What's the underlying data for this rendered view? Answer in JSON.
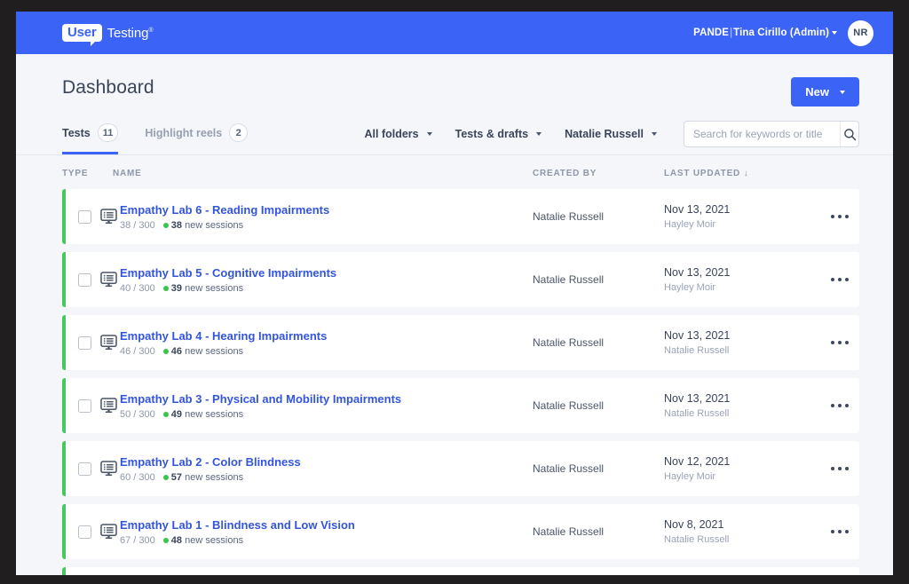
{
  "topbar": {
    "logo_bubble": "User",
    "logo_word": "Testing",
    "logo_tm": "®",
    "account_org": "PANDE",
    "account_separator": "|",
    "account_user": "Tina Cirillo (Admin)",
    "avatar_initials": "NR",
    "bar_color": "#3b63f5"
  },
  "header": {
    "title": "Dashboard",
    "new_button": "New"
  },
  "tabs": [
    {
      "label": "Tests",
      "count": "11",
      "active": true
    },
    {
      "label": "Highlight reels",
      "count": "2",
      "active": false
    }
  ],
  "filters": [
    {
      "label": "All folders"
    },
    {
      "label": "Tests & drafts"
    },
    {
      "label": "Natalie Russell"
    }
  ],
  "search": {
    "placeholder": "Search for keywords or title",
    "value": "",
    "icon": "search-icon"
  },
  "columns": {
    "type": "TYPE",
    "name": "NAME",
    "created_by": "CREATED BY",
    "last_updated": "LAST UPDATED",
    "sort_arrow": "↓"
  },
  "rows": [
    {
      "icon": "monitor-list-icon",
      "name": "Empathy Lab 6 - Reading Impairments",
      "progress": "38 / 300",
      "new_sessions_count": "38",
      "new_sessions_label": "new sessions",
      "created_by": "Natalie Russell",
      "last_updated": "Nov 13, 2021",
      "updated_by": "Hayley Moir"
    },
    {
      "icon": "monitor-list-icon",
      "name": "Empathy Lab 5 - Cognitive Impairments",
      "progress": "40 / 300",
      "new_sessions_count": "39",
      "new_sessions_label": "new sessions",
      "created_by": "Natalie Russell",
      "last_updated": "Nov 13, 2021",
      "updated_by": "Hayley Moir"
    },
    {
      "icon": "monitor-list-icon",
      "name": "Empathy Lab 4 - Hearing Impairments",
      "progress": "46 / 300",
      "new_sessions_count": "46",
      "new_sessions_label": "new sessions",
      "created_by": "Natalie Russell",
      "last_updated": "Nov 13, 2021",
      "updated_by": "Natalie Russell"
    },
    {
      "icon": "monitor-list-icon",
      "name": "Empathy Lab 3 - Physical and Mobility Impairments",
      "progress": "50 / 300",
      "new_sessions_count": "49",
      "new_sessions_label": "new sessions",
      "created_by": "Natalie Russell",
      "last_updated": "Nov 13, 2021",
      "updated_by": "Natalie Russell"
    },
    {
      "icon": "monitor-list-icon",
      "name": "Empathy Lab 2 - Color Blindness",
      "progress": "60 / 300",
      "new_sessions_count": "57",
      "new_sessions_label": "new sessions",
      "created_by": "Natalie Russell",
      "last_updated": "Nov 12, 2021",
      "updated_by": "Hayley Moir"
    },
    {
      "icon": "monitor-list-icon",
      "name": "Empathy Lab 1 - Blindness and Low Vision",
      "progress": "67 / 300",
      "new_sessions_count": "48",
      "new_sessions_label": "new sessions",
      "created_by": "Natalie Russell",
      "last_updated": "Nov 8, 2021",
      "updated_by": "Natalie Russell"
    }
  ],
  "colors": {
    "brand_blue": "#3b63f5",
    "link_blue": "#3355dd",
    "status_green": "#45c95f",
    "page_bg": "#f4f6f9",
    "text_dark": "#3a4559"
  }
}
